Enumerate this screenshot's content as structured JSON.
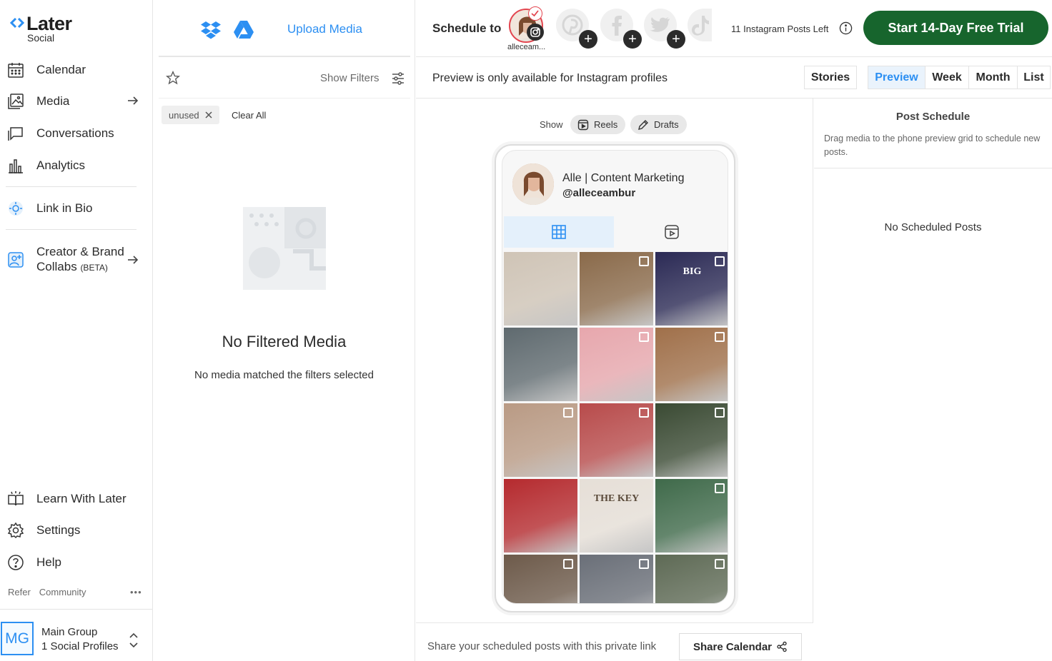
{
  "brand": {
    "name": "Later",
    "sub": "Social",
    "accent": "#2c8ff2",
    "cta_color": "#17652d"
  },
  "sidebar": {
    "items": [
      {
        "label": "Calendar",
        "icon": "calendar-icon"
      },
      {
        "label": "Media",
        "icon": "media-icon"
      },
      {
        "label": "Conversations",
        "icon": "chat-icon"
      },
      {
        "label": "Analytics",
        "icon": "analytics-icon"
      },
      {
        "label": "Link in Bio",
        "icon": "link-in-bio-icon"
      },
      {
        "label": "Creator & Brand",
        "label2": "Collabs",
        "badge": "(BETA)",
        "icon": "collabs-icon"
      },
      {
        "label": "Learn With Later",
        "icon": "book-icon"
      },
      {
        "label": "Settings",
        "icon": "gear-icon"
      },
      {
        "label": "Help",
        "icon": "help-icon"
      }
    ],
    "footer": {
      "refer": "Refer",
      "community": "Community",
      "more": "•••"
    },
    "group": {
      "initials": "MG",
      "name": "Main Group",
      "profiles": "1 Social Profiles"
    }
  },
  "media": {
    "upload_label": "Upload Media",
    "show_filters": "Show Filters",
    "chip": "unused",
    "clear_all": "Clear All",
    "empty_title": "No Filtered Media",
    "empty_sub": "No media matched the filters selected"
  },
  "topbar": {
    "schedule_to": "Schedule to",
    "profile_label": "alleceam...",
    "posts_left": "11 Instagram Posts Left",
    "trial_button": "Start 14-Day Free Trial"
  },
  "previewbar": {
    "note": "Preview is only available for Instagram profiles",
    "views": [
      "Stories",
      "Preview",
      "Week",
      "Month",
      "List"
    ],
    "active_view": "Preview"
  },
  "center": {
    "show_label": "Show",
    "reels_label": "Reels",
    "drafts_label": "Drafts",
    "profile_name": "Alle | Content Marketing",
    "profile_handle": "@alleceambur",
    "tiles": [
      {
        "bg": "#cfc4b6",
        "badge": false
      },
      {
        "bg": "#8a6a4a",
        "badge": true
      },
      {
        "bg": "#2b2a55",
        "badge": true,
        "text": "BIG"
      },
      {
        "bg": "#5f6a6f",
        "badge": false
      },
      {
        "bg": "#e7a7ad",
        "badge": true
      },
      {
        "bg": "#a0704a",
        "badge": true
      },
      {
        "bg": "#b99a84",
        "badge": true
      },
      {
        "bg": "#b84b4b",
        "badge": true
      },
      {
        "bg": "#3a4a33",
        "badge": true
      },
      {
        "bg": "#b52a2e",
        "badge": false
      },
      {
        "bg": "#e6dfd7",
        "badge": false,
        "text": "THE KEY"
      },
      {
        "bg": "#3f6a4a",
        "badge": true
      },
      {
        "bg": "#6d5a4a",
        "badge": true
      },
      {
        "bg": "#6a6f78",
        "badge": true
      },
      {
        "bg": "#5e6a55",
        "badge": true
      }
    ],
    "share_text": "Share your scheduled posts with this private link",
    "share_button": "Share Calendar"
  },
  "schedule": {
    "title": "Post Schedule",
    "description": "Drag media to the phone preview grid to schedule new posts.",
    "empty": "No Scheduled Posts"
  }
}
